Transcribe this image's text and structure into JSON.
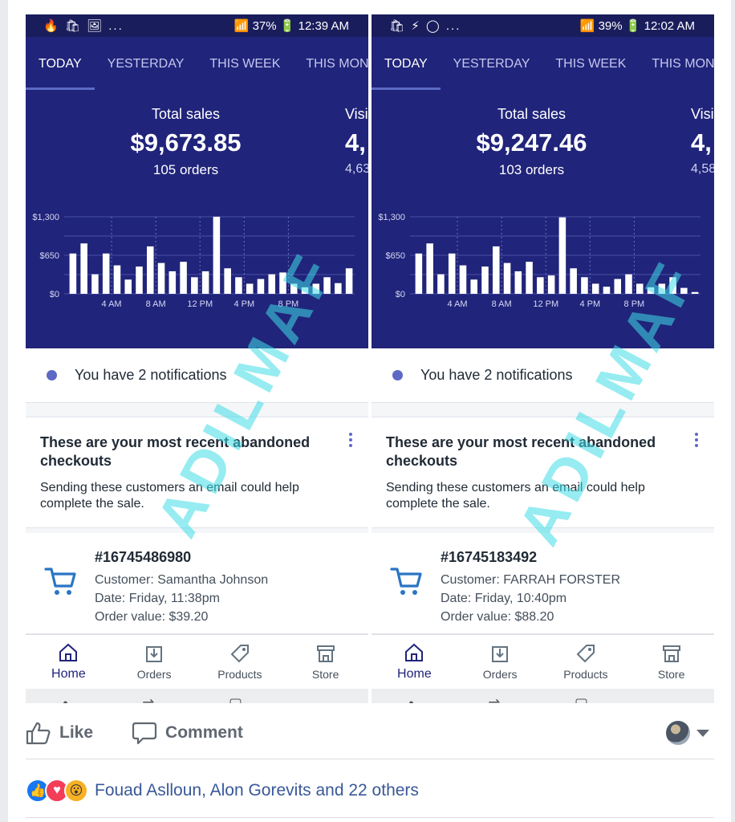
{
  "post": {
    "phones": [
      {
        "status": {
          "left": "🔥 🛍 🖼 ...",
          "right": "📶 37% 🔋 12:39 AM"
        },
        "tabs": [
          "TODAY",
          "YESTERDAY",
          "THIS WEEK",
          "THIS MONT"
        ],
        "total_sales_label": "Total sales",
        "total_sales_value": "$9,673.85",
        "orders": "105 orders",
        "side_label": "Visi",
        "side_value": "4,",
        "side_sub": "4,63",
        "notification": "You have 2 notifications",
        "card_title": "These are your most recent abandoned checkouts",
        "card_text": "Sending these customers an email could help complete the sale.",
        "order_id": "#16745486980",
        "customer": "Customer: Samantha Johnson",
        "date": "Date: Friday, 11:38pm",
        "value": "Order value: $39.20",
        "nav": [
          "Home",
          "Orders",
          "Products",
          "Store"
        ]
      },
      {
        "status": {
          "left": "🛍 ⚡ ◯ ...",
          "right": "📶 39% 🔋 12:02 AM"
        },
        "tabs": [
          "TODAY",
          "YESTERDAY",
          "THIS WEEK",
          "THIS MONT"
        ],
        "total_sales_label": "Total sales",
        "total_sales_value": "$9,247.46",
        "orders": "103 orders",
        "side_label": "Visi",
        "side_value": "4,",
        "side_sub": "4,58",
        "notification": "You have 2 notifications",
        "card_title": "These are your most recent abandoned checkouts",
        "card_text": "Sending these customers an email could help complete the sale.",
        "order_id": "#16745183492",
        "customer": "Customer: FARRAH FORSTER",
        "date": "Date: Friday, 10:40pm",
        "value": "Order value: $88.20",
        "nav": [
          "Home",
          "Orders",
          "Products",
          "Store"
        ]
      }
    ],
    "watermark": "ADILMAF",
    "actions": {
      "like": "Like",
      "comment": "Comment"
    },
    "reactions_text": "Fouad Aslloun, Alon Gorevits and 22 others"
  },
  "chart_data": [
    {
      "type": "bar",
      "yticks": [
        "$1,300",
        "$650",
        "$0"
      ],
      "ylim": [
        0,
        1300
      ],
      "xticks": [
        "4 AM",
        "8 AM",
        "12 PM",
        "4 PM",
        "8 PM"
      ],
      "values": [
        680,
        850,
        330,
        680,
        480,
        240,
        460,
        800,
        520,
        380,
        540,
        280,
        380,
        1300,
        430,
        280,
        170,
        250,
        330,
        360,
        170,
        110,
        170,
        280,
        180,
        430
      ]
    },
    {
      "type": "bar",
      "yticks": [
        "$1,300",
        "$650",
        "$0"
      ],
      "ylim": [
        0,
        1300
      ],
      "xticks": [
        "4 AM",
        "8 AM",
        "12 PM",
        "4 PM",
        "8 PM"
      ],
      "values": [
        680,
        850,
        330,
        680,
        480,
        240,
        460,
        800,
        520,
        380,
        540,
        280,
        310,
        1290,
        430,
        280,
        170,
        120,
        250,
        330,
        170,
        110,
        170,
        280,
        100,
        30
      ]
    }
  ]
}
